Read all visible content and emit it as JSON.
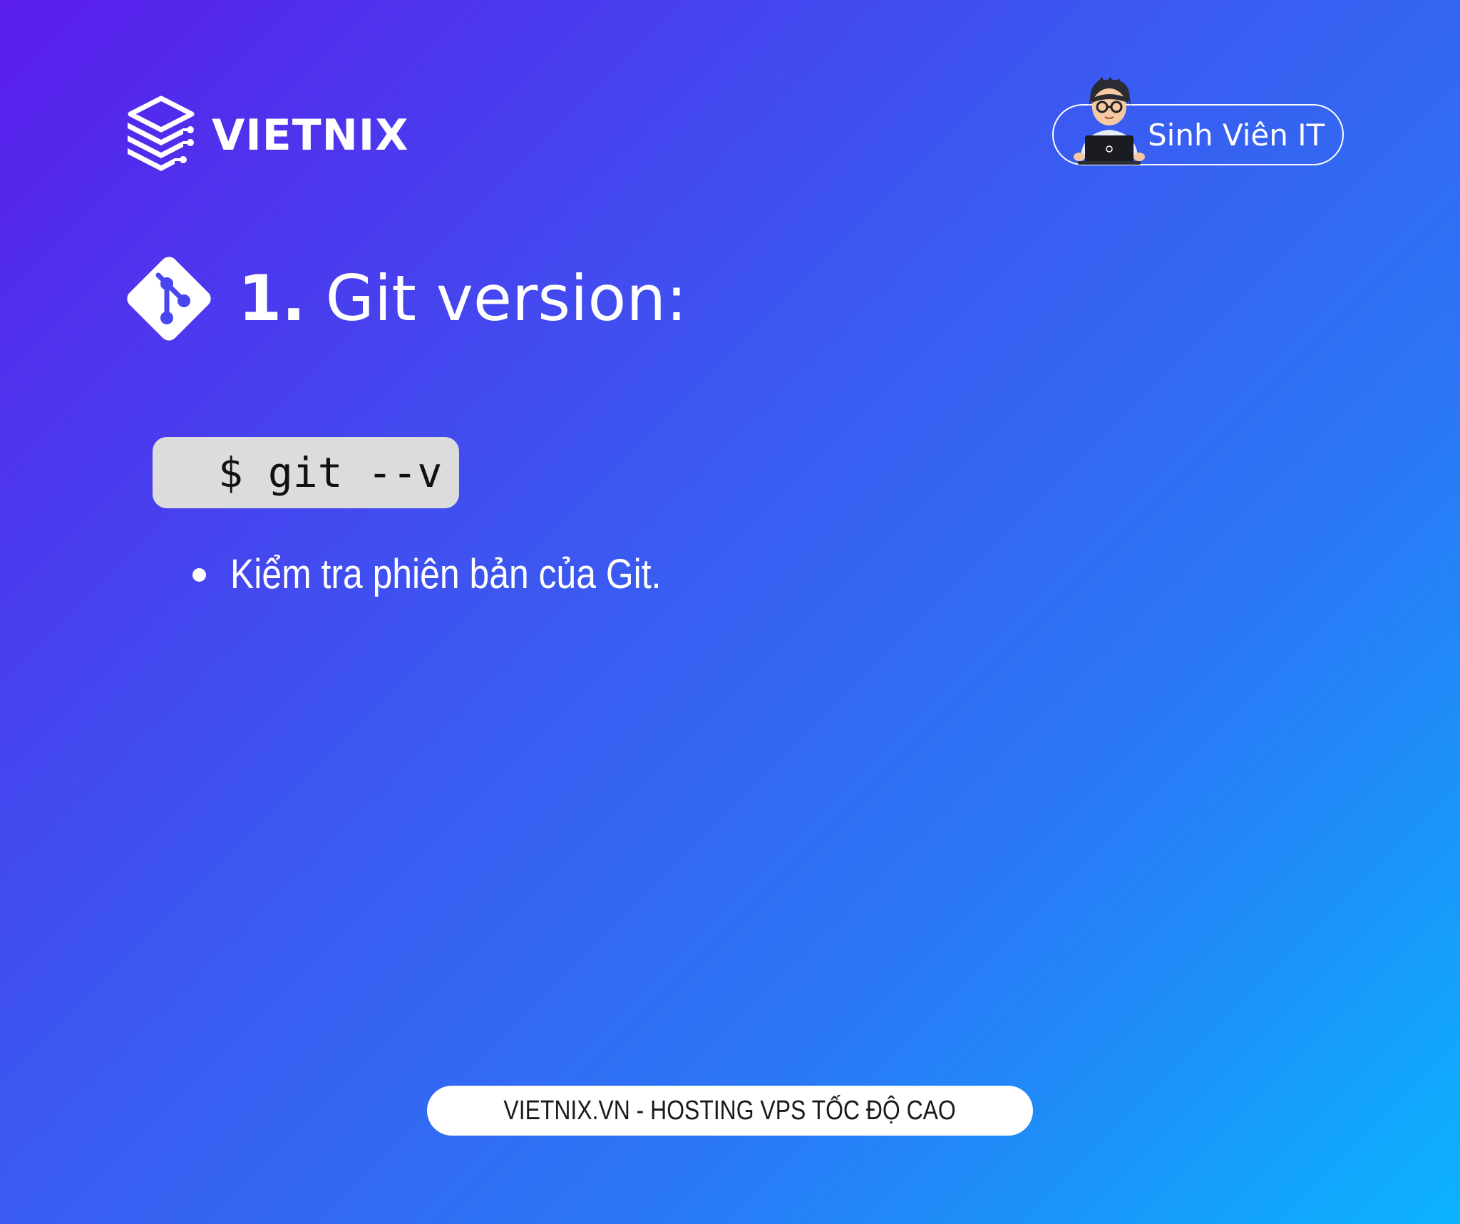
{
  "brand": {
    "logo_text": "VIETNIX",
    "logo_icon": "stacked-layers-icon"
  },
  "badge": {
    "label": "Sinh Viên IT",
    "avatar_icon": "student-with-laptop-avatar"
  },
  "heading": {
    "icon": "git-logo-icon",
    "number": "1.",
    "title": "Git version:"
  },
  "code": {
    "command": "$ git --v"
  },
  "bullets": [
    {
      "text": "Kiểm tra phiên bản của Git."
    }
  ],
  "footer": {
    "text": "VIETNIX.VN - HOSTING VPS TỐC ĐỘ CAO"
  },
  "colors": {
    "gradient_start": "#5a1deb",
    "gradient_mid": "#3d55f0",
    "gradient_end": "#0bb3fd",
    "code_bg": "#dcdcdc",
    "text": "#ffffff"
  }
}
